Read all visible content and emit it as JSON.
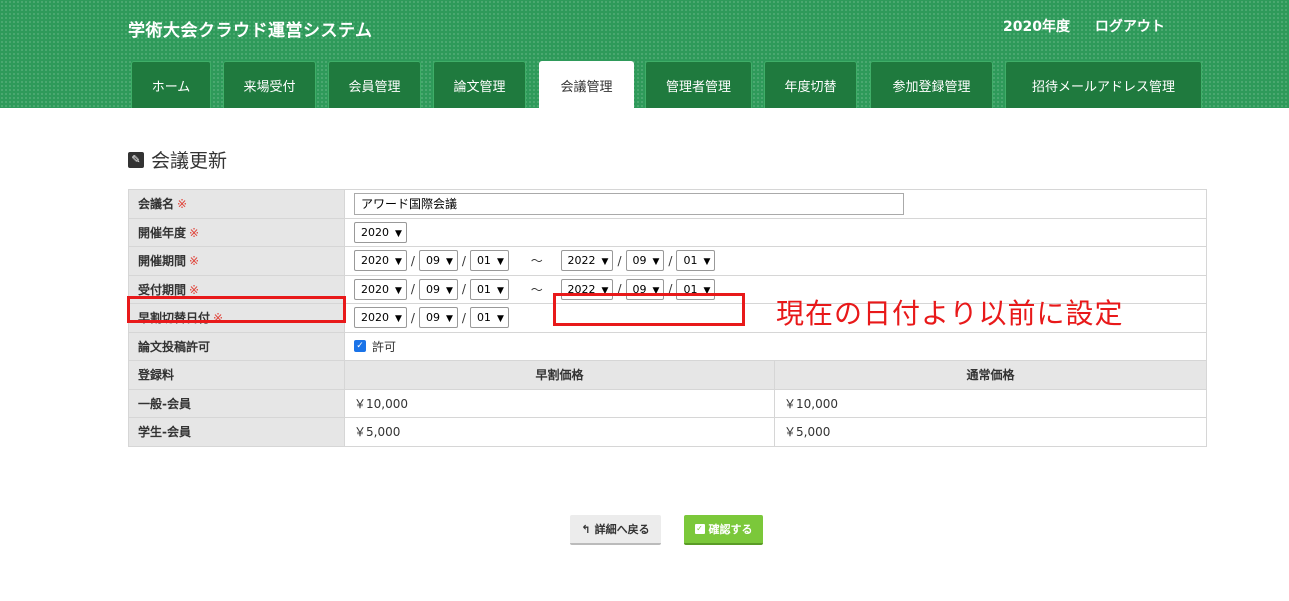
{
  "header": {
    "app_title": "学術大会クラウド運営システム",
    "year": "2020年度",
    "logout": "ログアウト"
  },
  "tabs": [
    {
      "label": "ホーム"
    },
    {
      "label": "来場受付"
    },
    {
      "label": "会員管理"
    },
    {
      "label": "論文管理"
    },
    {
      "label": "会議管理",
      "active": true
    },
    {
      "label": "管理者管理"
    },
    {
      "label": "年度切替"
    },
    {
      "label": "参加登録管理"
    },
    {
      "label": "招待メールアドレス管理"
    }
  ],
  "page_title": "会議更新",
  "required_mark": "※",
  "form": {
    "name": {
      "label": "会議名",
      "value": "アワード国際会議"
    },
    "year": {
      "label": "開催年度",
      "value": "2020"
    },
    "period": {
      "label": "開催期間",
      "start": {
        "year": "2020",
        "month": "09",
        "day": "01"
      },
      "end": {
        "year": "2022",
        "month": "09",
        "day": "01"
      }
    },
    "reception": {
      "label": "受付期間",
      "start": {
        "year": "2020",
        "month": "09",
        "day": "01"
      },
      "end": {
        "year": "2022",
        "month": "09",
        "day": "01"
      }
    },
    "early_date": {
      "label": "早割切替日付",
      "date": {
        "year": "2020",
        "month": "09",
        "day": "01"
      }
    },
    "paper_permission": {
      "label": "論文投稿許可",
      "checkbox_label": "許可",
      "checked": true
    },
    "fees": {
      "label": "登録料",
      "col_early": "早割価格",
      "col_regular": "通常価格",
      "rows": [
        {
          "label": "一般-会員",
          "early": "￥10,000",
          "regular": "￥10,000"
        },
        {
          "label": "学生-会員",
          "early": "￥5,000",
          "regular": "￥5,000"
        }
      ]
    },
    "separator": "/",
    "tilde": "～"
  },
  "annotation": "現在の日付より以前に設定",
  "buttons": {
    "back": "詳細へ戻る",
    "confirm": "確認する"
  },
  "colors": {
    "header_green": "#2e9a5a",
    "tab_green": "#1f7a3e",
    "annotation_red": "#e8191a",
    "confirm_green": "#7bc83a"
  }
}
